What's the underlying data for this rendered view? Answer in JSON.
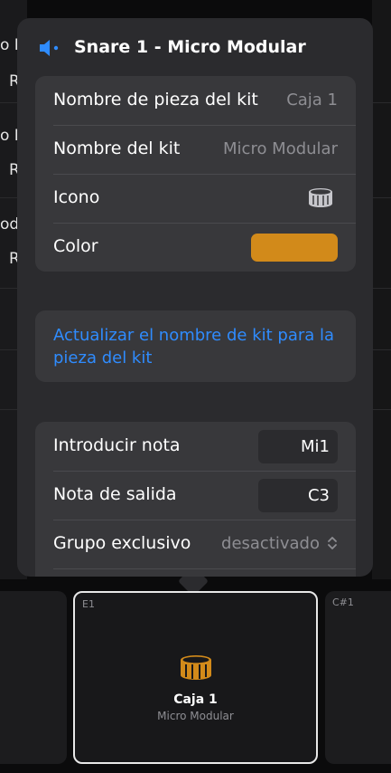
{
  "background": {
    "labels": [
      "o M",
      "R",
      "o M",
      "R",
      "odu",
      "R"
    ]
  },
  "popover": {
    "title": "Snare 1 - Micro Modular",
    "icon": "speaker-icon",
    "details": {
      "piece_name_label": "Nombre de pieza del kit",
      "piece_name_value": "Caja 1",
      "kit_name_label": "Nombre del kit",
      "kit_name_value": "Micro Modular",
      "icon_label": "Icono",
      "icon_value": "snare-drum-icon",
      "color_label": "Color",
      "color_value": "#d28a1a"
    },
    "update_link": "Actualizar el nombre de kit para la pieza del kit",
    "notes": {
      "input_note_label": "Introducir nota",
      "input_note_value": "Mi1",
      "output_note_label": "Nota de salida",
      "output_note_value": "C3",
      "exclusive_group_label": "Grupo exclusivo",
      "exclusive_group_value": "desactivado"
    }
  },
  "pads": {
    "selected": {
      "note": "E1",
      "name": "Caja 1",
      "kit": "Micro Modular",
      "icon": "snare-drum-icon",
      "accent": "#d28a1a"
    },
    "right_note": "C#1"
  }
}
